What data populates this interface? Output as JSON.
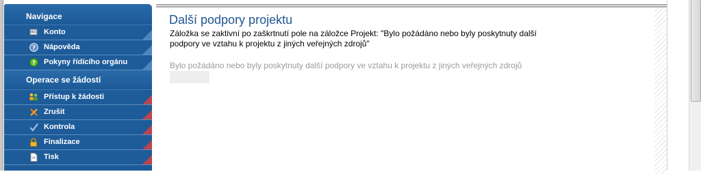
{
  "sidebar": {
    "sections": [
      {
        "title": "Navigace",
        "items": [
          {
            "label": "Konto",
            "icon": "account-icon"
          },
          {
            "label": "Nápověda",
            "icon": "help-icon"
          },
          {
            "label": "Pokyny řídícího orgánu",
            "icon": "instructions-icon"
          }
        ]
      },
      {
        "title": "Operace se žádostí",
        "items": [
          {
            "label": "Přístup k žádosti",
            "icon": "users-icon"
          },
          {
            "label": "Zrušit",
            "icon": "cancel-tools-icon"
          },
          {
            "label": "Kontrola",
            "icon": "check-icon"
          },
          {
            "label": "Finalizace",
            "icon": "lock-icon"
          },
          {
            "label": "Tisk",
            "icon": "print-document-icon"
          }
        ]
      }
    ]
  },
  "main": {
    "title": "Další podpory projektu",
    "description": "Záložka se zaktivní po zaškrtnutí pole na záložce Projekt: \"Bylo požádáno nebo byly poskytnuty další podpory ve vztahu k projektu z jiných veřejných zdrojů\"",
    "field": {
      "label": "Bylo požádáno nebo byly poskytnuty další podpory ve vztahu k projektu z jiných veřejných zdrojů",
      "value": ""
    }
  },
  "colors": {
    "sidebar_bg": "#1c5a98",
    "title_color": "#1f5690",
    "corner_red": "#b8454f",
    "corner_blue": "#4f86bf"
  }
}
